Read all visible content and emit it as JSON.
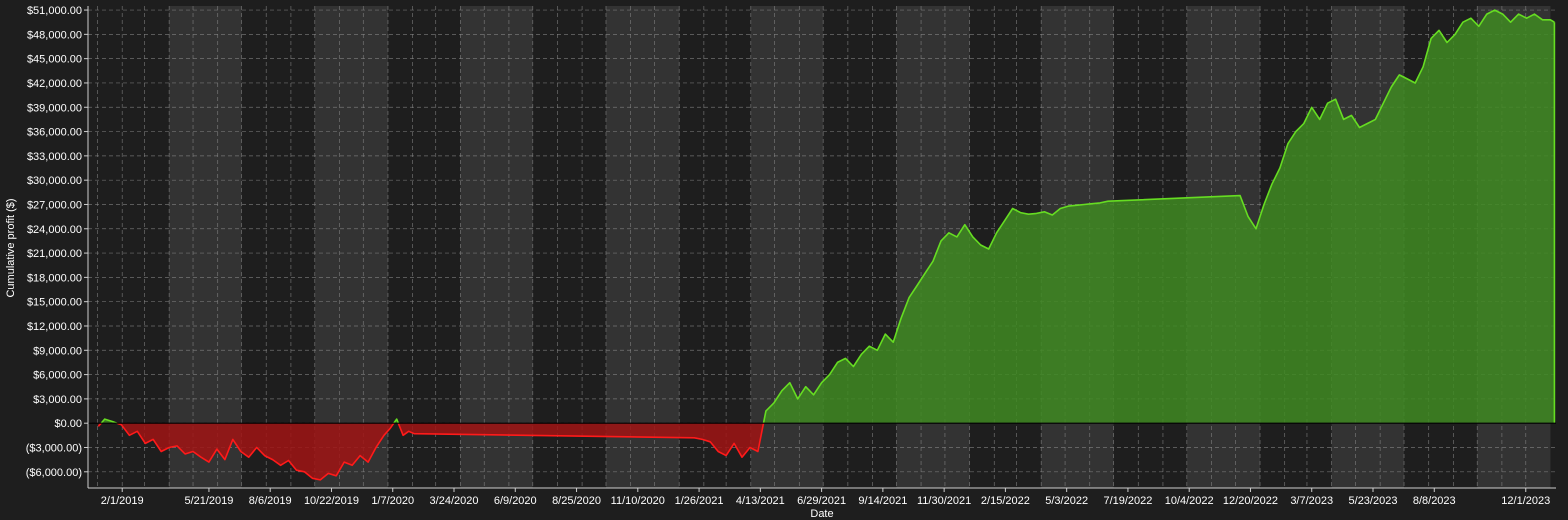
{
  "chart_data": {
    "type": "area",
    "title": "",
    "xlabel": "Date",
    "ylabel": "Cumulative profit ($)",
    "ylim": [
      -8000,
      51500
    ],
    "grid": true,
    "legend": "none",
    "x_ticks": [
      "2/1/2019",
      "5/21/2019",
      "8/6/2019",
      "10/22/2019",
      "1/7/2020",
      "3/24/2020",
      "6/9/2020",
      "8/25/2020",
      "11/10/2020",
      "1/26/2021",
      "4/13/2021",
      "6/29/2021",
      "9/14/2021",
      "11/30/2021",
      "2/15/2022",
      "5/3/2022",
      "7/19/2022",
      "10/4/2022",
      "12/20/2022",
      "3/7/2023",
      "5/23/2023",
      "8/8/2023",
      "12/1/2023"
    ],
    "y_ticks": [
      {
        "value": 51000,
        "label": "$51,000.00"
      },
      {
        "value": 48000,
        "label": "$48,000.00"
      },
      {
        "value": 45000,
        "label": "$45,000.00"
      },
      {
        "value": 42000,
        "label": "$42,000.00"
      },
      {
        "value": 39000,
        "label": "$39,000.00"
      },
      {
        "value": 36000,
        "label": "$36,000.00"
      },
      {
        "value": 33000,
        "label": "$33,000.00"
      },
      {
        "value": 30000,
        "label": "$30,000.00"
      },
      {
        "value": 27000,
        "label": "$27,000.00"
      },
      {
        "value": 24000,
        "label": "$24,000.00"
      },
      {
        "value": 21000,
        "label": "$21,000.00"
      },
      {
        "value": 18000,
        "label": "$18,000.00"
      },
      {
        "value": 15000,
        "label": "$15,000.00"
      },
      {
        "value": 12000,
        "label": "$12,000.00"
      },
      {
        "value": 9000,
        "label": "$9,000.00"
      },
      {
        "value": 6000,
        "label": "$6,000.00"
      },
      {
        "value": 3000,
        "label": "$3,000.00"
      },
      {
        "value": 0,
        "label": "$0.00"
      },
      {
        "value": -3000,
        "label": "($3,000.00)"
      },
      {
        "value": -6000,
        "label": "($6,000.00)"
      }
    ],
    "colors": {
      "positive_line": "#66dd22",
      "positive_fill": "#3f8a22",
      "negative_line": "#ff1a1a",
      "negative_fill": "#a01414",
      "background": "#1e1e1e",
      "band": "#333333",
      "grid": "#8a8a8a"
    },
    "series": [
      {
        "x": [
          "2019-01-02",
          "2019-01-10",
          "2019-01-20",
          "2019-01-31",
          "2019-02-10",
          "2019-02-20",
          "2019-03-02",
          "2019-03-12",
          "2019-03-22",
          "2019-04-01",
          "2019-04-11",
          "2019-04-21",
          "2019-05-01",
          "2019-05-11",
          "2019-05-21",
          "2019-05-31",
          "2019-06-10",
          "2019-06-20",
          "2019-06-30",
          "2019-07-10",
          "2019-07-20",
          "2019-07-30",
          "2019-08-09",
          "2019-08-19",
          "2019-08-29",
          "2019-09-08",
          "2019-09-18",
          "2019-09-28",
          "2019-10-08",
          "2019-10-18",
          "2019-10-28",
          "2019-11-07",
          "2019-11-17",
          "2019-11-27",
          "2019-12-07",
          "2019-12-17",
          "2019-12-27",
          "2020-01-04",
          "2020-01-12",
          "2020-01-20",
          "2020-01-27",
          "2020-02-03",
          "2021-01-20",
          "2021-01-30",
          "2021-02-09",
          "2021-02-19",
          "2021-03-01",
          "2021-03-11",
          "2021-03-21",
          "2021-03-31",
          "2021-04-10",
          "2021-04-20",
          "2021-04-30",
          "2021-05-10",
          "2021-05-20",
          "2021-05-30",
          "2021-06-09",
          "2021-06-19",
          "2021-06-29",
          "2021-07-09",
          "2021-07-19",
          "2021-07-29",
          "2021-08-08",
          "2021-08-18",
          "2021-08-28",
          "2021-09-07",
          "2021-09-17",
          "2021-09-27",
          "2021-10-07",
          "2021-10-17",
          "2021-10-27",
          "2021-11-06",
          "2021-11-16",
          "2021-11-26",
          "2021-12-06",
          "2021-12-16",
          "2021-12-26",
          "2022-01-05",
          "2022-01-15",
          "2022-01-25",
          "2022-02-04",
          "2022-02-14",
          "2022-02-24",
          "2022-03-06",
          "2022-03-16",
          "2022-03-26",
          "2022-04-05",
          "2022-04-15",
          "2022-04-25",
          "2022-05-05",
          "2022-05-15",
          "2022-05-25",
          "2022-06-04",
          "2022-06-14",
          "2022-06-24",
          "2022-12-07",
          "2022-12-17",
          "2022-12-27",
          "2023-01-06",
          "2023-01-16",
          "2023-01-26",
          "2023-02-05",
          "2023-02-15",
          "2023-02-25",
          "2023-03-07",
          "2023-03-17",
          "2023-03-27",
          "2023-04-06",
          "2023-04-16",
          "2023-04-26",
          "2023-05-06",
          "2023-05-16",
          "2023-05-26",
          "2023-06-05",
          "2023-06-15",
          "2023-06-25",
          "2023-07-05",
          "2023-07-15",
          "2023-07-25",
          "2023-08-04",
          "2023-08-14",
          "2023-08-24",
          "2023-09-03",
          "2023-09-13",
          "2023-09-23",
          "2023-10-03",
          "2023-10-13",
          "2023-10-23",
          "2023-11-02",
          "2023-11-12",
          "2023-11-22",
          "2023-12-02",
          "2023-12-12",
          "2023-12-22",
          "2024-01-01",
          "2024-01-06"
        ],
        "values": [
          -400,
          500,
          200,
          -200,
          -1500,
          -1000,
          -2500,
          -2000,
          -3500,
          -3000,
          -2800,
          -3800,
          -3500,
          -4200,
          -4800,
          -3200,
          -4500,
          -2000,
          -3500,
          -4200,
          -3000,
          -4000,
          -4500,
          -5200,
          -4600,
          -5800,
          -6000,
          -6800,
          -7000,
          -6200,
          -6500,
          -4800,
          -5200,
          -4000,
          -4800,
          -3000,
          -1500,
          -600,
          500,
          -1500,
          -1000,
          -1300,
          -1800,
          -2000,
          -2300,
          -3500,
          -4000,
          -2500,
          -4200,
          -3000,
          -3500,
          1500,
          2500,
          4000,
          5000,
          3000,
          4500,
          3500,
          5000,
          6000,
          7500,
          8000,
          7000,
          8500,
          9500,
          9000,
          11000,
          10000,
          13000,
          15500,
          17000,
          18500,
          20000,
          22500,
          23500,
          23000,
          24500,
          23000,
          22000,
          21500,
          23500,
          25000,
          26500,
          26000,
          25800,
          25900,
          26100,
          25700,
          26500,
          26800,
          26900,
          27000,
          27100,
          27200,
          27400,
          28100,
          25500,
          24000,
          27000,
          29500,
          31500,
          34500,
          36000,
          37000,
          39000,
          37500,
          39500,
          40000,
          37500,
          38000,
          36500,
          37000,
          37500,
          39500,
          41500,
          43000,
          42500,
          42000,
          44000,
          47500,
          48500,
          47000,
          48000,
          49500,
          50000,
          49000,
          50500,
          51000,
          50500,
          49500,
          50500,
          50000,
          50500,
          49800,
          49800,
          49500
        ]
      }
    ]
  }
}
